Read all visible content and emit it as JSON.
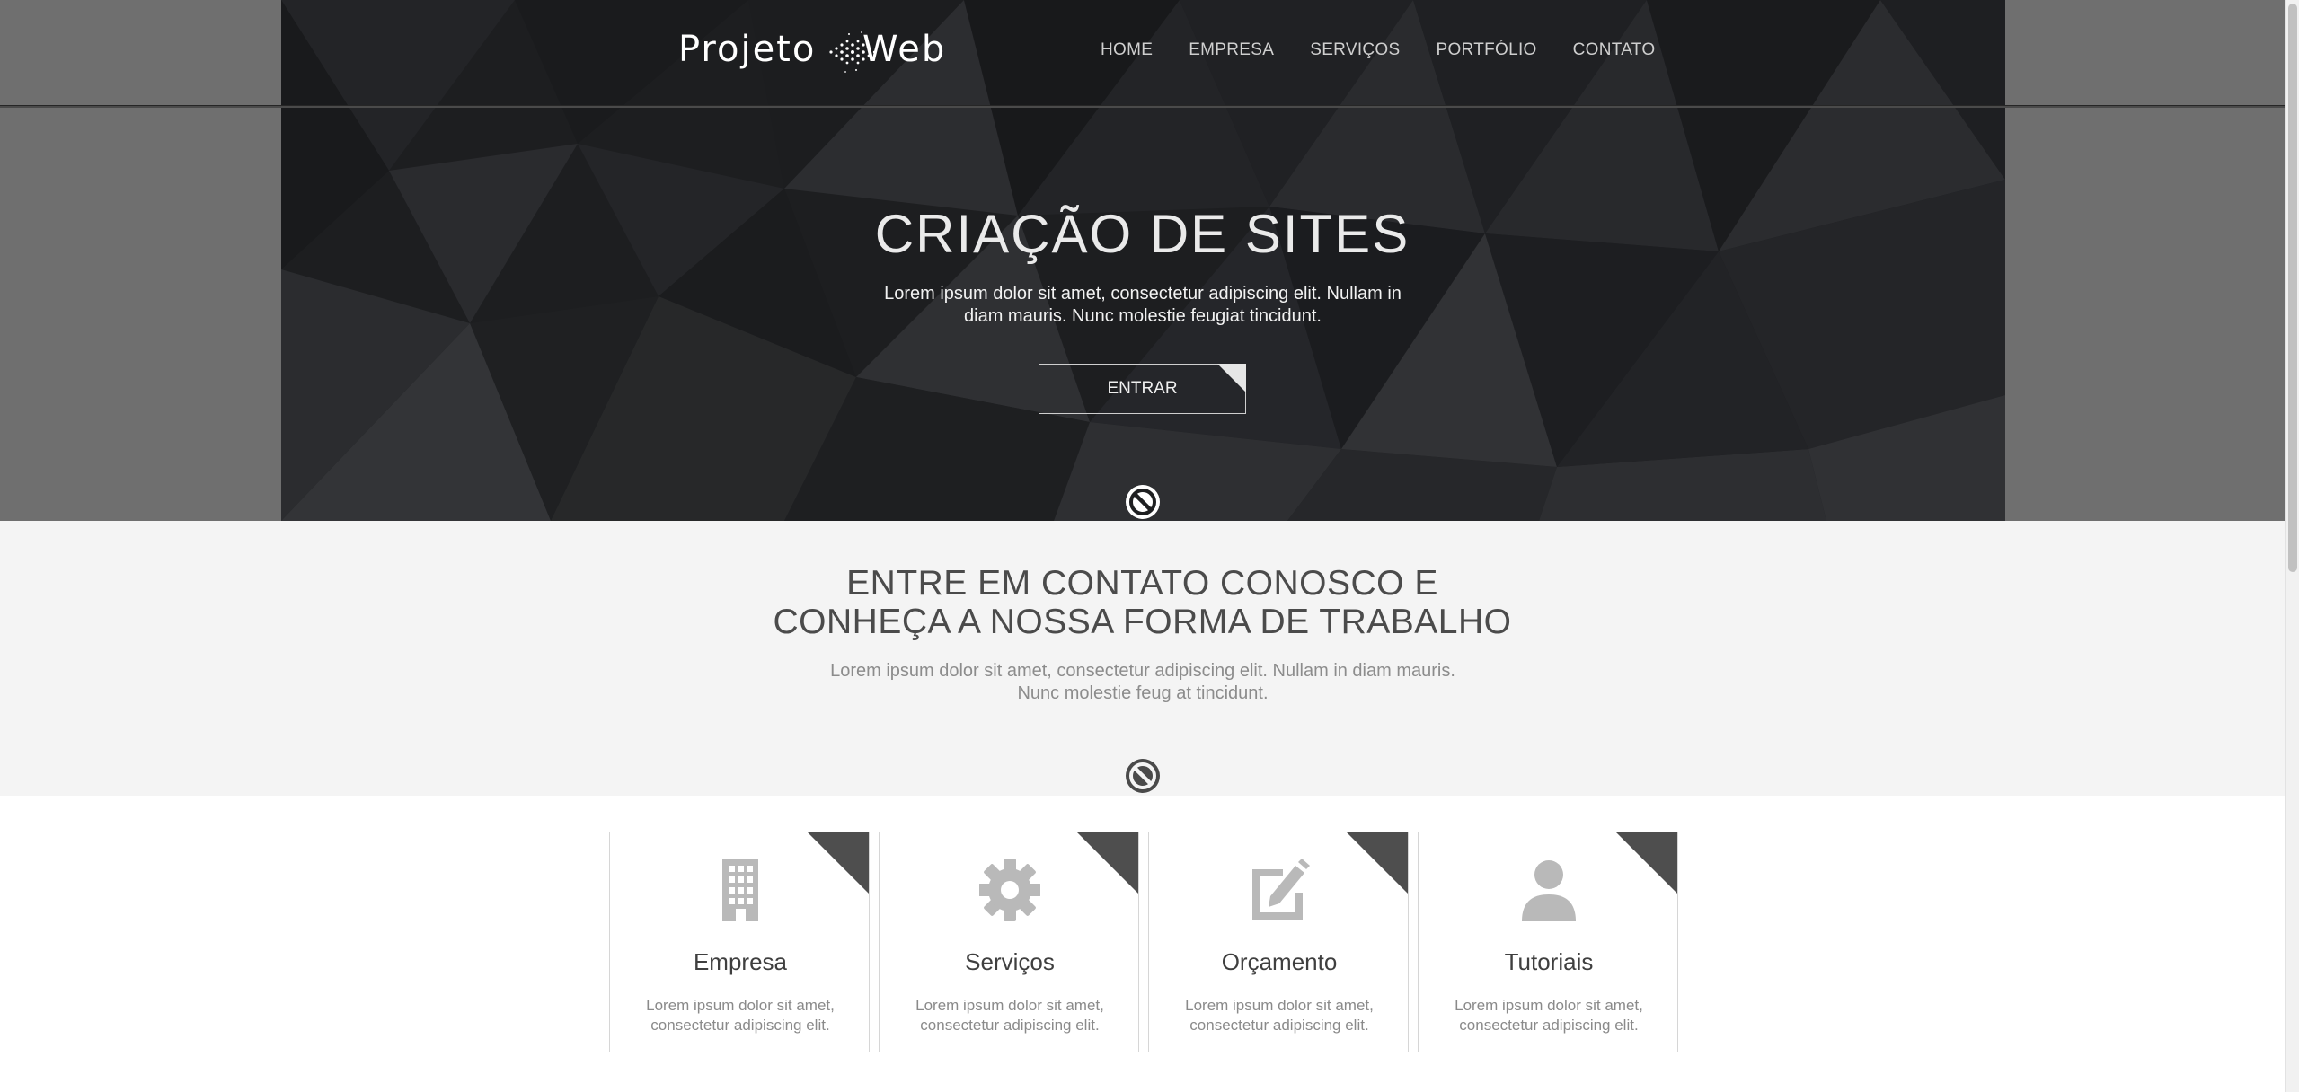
{
  "header": {
    "logo_left": "Projeto",
    "logo_right": "Web",
    "nav": [
      "HOME",
      "EMPRESA",
      "SERVIÇOS",
      "PORTFÓLIO",
      "CONTATO"
    ]
  },
  "hero": {
    "title": "CRIAÇÃO DE SITES",
    "text": "Lorem ipsum dolor sit amet, consectetur adipiscing elit. Nullam in diam mauris. Nunc molestie feugiat tincidunt.",
    "button_label": "ENTRAR"
  },
  "contact": {
    "title_line1": "ENTRE EM CONTATO CONOSCO E",
    "title_line2": "CONHEÇA A NOSSA FORMA DE TRABALHO",
    "text": "Lorem ipsum dolor sit amet, consectetur adipiscing elit. Nullam in diam mauris. Nunc molestie feug at tincidunt."
  },
  "cards": [
    {
      "title": "Empresa",
      "text": "Lorem ipsum dolor sit amet, consectetur adipiscing elit.",
      "icon": "building-icon"
    },
    {
      "title": "Serviços",
      "text": "Lorem ipsum dolor sit amet, consectetur adipiscing elit.",
      "icon": "gear-icon"
    },
    {
      "title": "Orçamento",
      "text": "Lorem ipsum dolor sit amet, consectetur adipiscing elit.",
      "icon": "edit-icon"
    },
    {
      "title": "Tutoriais",
      "text": "Lorem ipsum dolor sit amet, consectetur adipiscing elit.",
      "icon": "user-icon"
    }
  ],
  "colors": {
    "hero_bg": "#1e1f21",
    "side_bg": "#6f6f6f",
    "contact_bg": "#f4f4f4",
    "corner_dark": "#4e4e4e",
    "icon_gray": "#b9b9b9"
  }
}
